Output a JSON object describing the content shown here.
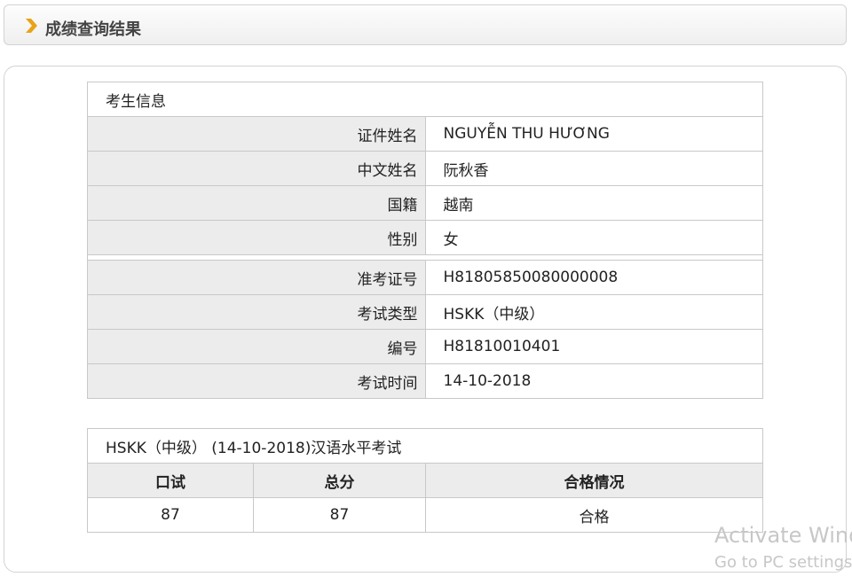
{
  "header": {
    "title": "成绩查询结果",
    "icon": "chevron-right-icon",
    "accent": "#e8a317"
  },
  "candidate": {
    "section_title": "考生信息",
    "rows": [
      {
        "label": "证件姓名",
        "value": "NGUYỄN THU HƯƠNG"
      },
      {
        "label": "中文姓名",
        "value": "阮秋香"
      },
      {
        "label": "国籍",
        "value": "越南"
      },
      {
        "label": "性别",
        "value": "女"
      }
    ],
    "exam_rows": [
      {
        "label": "准考证号",
        "value": "H81805850080000008"
      },
      {
        "label": "考试类型",
        "value": "HSKK（中级）"
      },
      {
        "label": "编号",
        "value": "H81810010401"
      },
      {
        "label": "考试时间",
        "value": "14-10-2018"
      }
    ]
  },
  "score": {
    "section_title": "HSKK（中级） (14-10-2018)汉语水平考试",
    "headers": [
      "口试",
      "总分",
      "合格情况"
    ],
    "values": [
      "87",
      "87",
      "合格"
    ]
  },
  "watermark": {
    "line1": "Activate Wind",
    "line2": "Go to PC settings"
  }
}
